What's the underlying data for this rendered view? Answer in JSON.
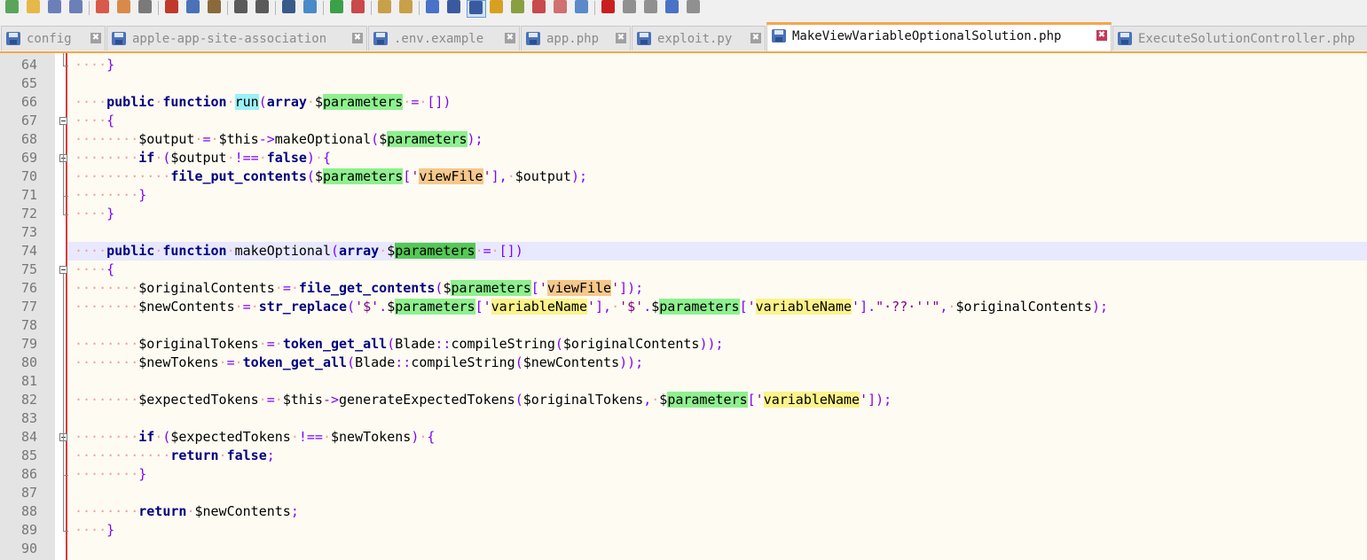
{
  "toolbar": {
    "buttons": [
      "new-file-icon",
      "open-file-icon",
      "save-icon",
      "save-all-icon",
      "close-icon",
      "close-all-icon",
      "print-icon",
      "cut-icon",
      "copy-icon",
      "paste-icon",
      "undo-icon",
      "redo-icon",
      "find-icon",
      "replace-icon",
      "zoom-in-icon",
      "zoom-out-icon",
      "sync-vertical-icon",
      "sync-horizontal-icon",
      "word-wrap-icon",
      "show-all-chars-icon",
      "indent-guide-icon",
      "language-icon",
      "document-map-icon",
      "function-list-icon",
      "folder-workspace-icon",
      "monitoring-icon",
      "record-macro-icon",
      "stop-macro-icon",
      "play-macro-icon",
      "run-macro-multiple-icon",
      "save-macro-icon"
    ]
  },
  "tabs": [
    {
      "label": "config",
      "active": false
    },
    {
      "label": "apple-app-site-association",
      "active": false
    },
    {
      "label": ".env.example",
      "active": false
    },
    {
      "label": "app.php",
      "active": false
    },
    {
      "label": "exploit.py",
      "active": false
    },
    {
      "label": "MakeViewVariableOptionalSolution.php",
      "active": true
    },
    {
      "label": "ExecuteSolutionController.php",
      "active": false
    }
  ],
  "colors": {
    "tab_accent": "#f5a54a",
    "keyword": "#000080",
    "operator": "#8000ff",
    "string": "#800080",
    "whitespace_dots": "#f0a0a0",
    "smart_highlight": "#8ef08e",
    "current_line": "#e8e8ff",
    "change_marker": "#d93b3b"
  },
  "editor": {
    "current_line": 74,
    "lines": [
      {
        "n": "64",
        "fold": "end",
        "tokens": [
          [
            "d",
            "····"
          ],
          [
            "op",
            "}"
          ]
        ]
      },
      {
        "n": "65",
        "fold": "",
        "tokens": []
      },
      {
        "n": "66",
        "fold": "",
        "tokens": [
          [
            "d",
            "····"
          ],
          [
            "kw",
            "public"
          ],
          [
            "d",
            "·"
          ],
          [
            "kw",
            "function"
          ],
          [
            "d",
            "·"
          ],
          [
            "c",
            "run"
          ],
          [
            "op",
            "("
          ],
          [
            "kw",
            "array"
          ],
          [
            "d",
            "·"
          ],
          [
            "pl",
            "$"
          ],
          [
            "g",
            "parameters"
          ],
          [
            "d",
            "·"
          ],
          [
            "op",
            "="
          ],
          [
            "d",
            "·"
          ],
          [
            "op",
            "[])"
          ]
        ]
      },
      {
        "n": "67",
        "fold": "start",
        "tokens": [
          [
            "d",
            "····"
          ],
          [
            "op",
            "{"
          ]
        ]
      },
      {
        "n": "68",
        "fold": "",
        "tokens": [
          [
            "d",
            "········"
          ],
          [
            "pl",
            "$output"
          ],
          [
            "d",
            "·"
          ],
          [
            "op",
            "="
          ],
          [
            "d",
            "·"
          ],
          [
            "pl",
            "$this"
          ],
          [
            "op",
            "->"
          ],
          [
            "pl",
            "makeOptional"
          ],
          [
            "op",
            "("
          ],
          [
            "pl",
            "$"
          ],
          [
            "g",
            "parameters"
          ],
          [
            "op",
            ");"
          ]
        ]
      },
      {
        "n": "69",
        "fold": "start",
        "tokens": [
          [
            "d",
            "········"
          ],
          [
            "kw",
            "if"
          ],
          [
            "d",
            "·"
          ],
          [
            "op",
            "("
          ],
          [
            "pl",
            "$output"
          ],
          [
            "d",
            "·"
          ],
          [
            "op",
            "!=="
          ],
          [
            "d",
            "·"
          ],
          [
            "kw",
            "false"
          ],
          [
            "op",
            ")"
          ],
          [
            "d",
            "·"
          ],
          [
            "op",
            "{"
          ]
        ]
      },
      {
        "n": "70",
        "fold": "",
        "tokens": [
          [
            "d",
            "············"
          ],
          [
            "kw",
            "file_put_contents"
          ],
          [
            "op",
            "("
          ],
          [
            "pl",
            "$"
          ],
          [
            "g",
            "parameters"
          ],
          [
            "op",
            "["
          ],
          [
            "str",
            "'"
          ],
          [
            "o",
            "viewFile"
          ],
          [
            "str",
            "'"
          ],
          [
            "op",
            "],"
          ],
          [
            "d",
            "·"
          ],
          [
            "pl",
            "$output"
          ],
          [
            "op",
            ");"
          ]
        ]
      },
      {
        "n": "71",
        "fold": "end",
        "tokens": [
          [
            "d",
            "········"
          ],
          [
            "op",
            "}"
          ]
        ]
      },
      {
        "n": "72",
        "fold": "end",
        "tokens": [
          [
            "d",
            "····"
          ],
          [
            "op",
            "}"
          ]
        ]
      },
      {
        "n": "73",
        "fold": "",
        "tokens": []
      },
      {
        "n": "74",
        "fold": "",
        "tokens": [
          [
            "d",
            "····"
          ],
          [
            "kw",
            "public"
          ],
          [
            "d",
            "·"
          ],
          [
            "kw",
            "function"
          ],
          [
            "d",
            "·"
          ],
          [
            "pl",
            "makeOptional"
          ],
          [
            "op",
            "("
          ],
          [
            "kw",
            "array"
          ],
          [
            "d",
            "·"
          ],
          [
            "pl",
            "$"
          ],
          [
            "gd",
            "parameters"
          ],
          [
            "d",
            "·"
          ],
          [
            "op",
            "="
          ],
          [
            "d",
            "·"
          ],
          [
            "op",
            "[])"
          ]
        ]
      },
      {
        "n": "75",
        "fold": "start",
        "tokens": [
          [
            "d",
            "····"
          ],
          [
            "op",
            "{"
          ]
        ]
      },
      {
        "n": "76",
        "fold": "",
        "tokens": [
          [
            "d",
            "········"
          ],
          [
            "pl",
            "$originalContents"
          ],
          [
            "d",
            "·"
          ],
          [
            "op",
            "="
          ],
          [
            "d",
            "·"
          ],
          [
            "kw",
            "file_get_contents"
          ],
          [
            "op",
            "("
          ],
          [
            "pl",
            "$"
          ],
          [
            "g",
            "parameters"
          ],
          [
            "op",
            "["
          ],
          [
            "str",
            "'"
          ],
          [
            "o",
            "viewFile"
          ],
          [
            "str",
            "'"
          ],
          [
            "op",
            "]);"
          ]
        ]
      },
      {
        "n": "77",
        "fold": "",
        "tokens": [
          [
            "d",
            "········"
          ],
          [
            "pl",
            "$newContents"
          ],
          [
            "d",
            "·"
          ],
          [
            "op",
            "="
          ],
          [
            "d",
            "·"
          ],
          [
            "kw",
            "str_replace"
          ],
          [
            "op",
            "("
          ],
          [
            "str",
            "'$'"
          ],
          [
            "op",
            "."
          ],
          [
            "pl",
            "$"
          ],
          [
            "g",
            "parameters"
          ],
          [
            "op",
            "["
          ],
          [
            "str",
            "'"
          ],
          [
            "y",
            "variableName"
          ],
          [
            "str",
            "'"
          ],
          [
            "op",
            "],"
          ],
          [
            "d",
            "·"
          ],
          [
            "str",
            "'$'"
          ],
          [
            "op",
            "."
          ],
          [
            "pl",
            "$"
          ],
          [
            "g",
            "parameters"
          ],
          [
            "op",
            "["
          ],
          [
            "str",
            "'"
          ],
          [
            "y",
            "variableName"
          ],
          [
            "str",
            "'"
          ],
          [
            "op",
            "]."
          ],
          [
            "str",
            "\"·??·''\""
          ],
          [
            "op",
            ","
          ],
          [
            "d",
            "·"
          ],
          [
            "pl",
            "$originalContents"
          ],
          [
            "op",
            ");"
          ]
        ]
      },
      {
        "n": "78",
        "fold": "",
        "tokens": []
      },
      {
        "n": "79",
        "fold": "",
        "tokens": [
          [
            "d",
            "········"
          ],
          [
            "pl",
            "$originalTokens"
          ],
          [
            "d",
            "·"
          ],
          [
            "op",
            "="
          ],
          [
            "d",
            "·"
          ],
          [
            "kw",
            "token_get_all"
          ],
          [
            "op",
            "("
          ],
          [
            "pl",
            "Blade"
          ],
          [
            "op",
            "::"
          ],
          [
            "pl",
            "compileString"
          ],
          [
            "op",
            "("
          ],
          [
            "pl",
            "$originalContents"
          ],
          [
            "op",
            "));"
          ]
        ]
      },
      {
        "n": "80",
        "fold": "",
        "tokens": [
          [
            "d",
            "········"
          ],
          [
            "pl",
            "$newTokens"
          ],
          [
            "d",
            "·"
          ],
          [
            "op",
            "="
          ],
          [
            "d",
            "·"
          ],
          [
            "kw",
            "token_get_all"
          ],
          [
            "op",
            "("
          ],
          [
            "pl",
            "Blade"
          ],
          [
            "op",
            "::"
          ],
          [
            "pl",
            "compileString"
          ],
          [
            "op",
            "("
          ],
          [
            "pl",
            "$newContents"
          ],
          [
            "op",
            "));"
          ]
        ]
      },
      {
        "n": "81",
        "fold": "",
        "tokens": []
      },
      {
        "n": "82",
        "fold": "",
        "tokens": [
          [
            "d",
            "········"
          ],
          [
            "pl",
            "$expectedTokens"
          ],
          [
            "d",
            "·"
          ],
          [
            "op",
            "="
          ],
          [
            "d",
            "·"
          ],
          [
            "pl",
            "$this"
          ],
          [
            "op",
            "->"
          ],
          [
            "pl",
            "generateExpectedTokens"
          ],
          [
            "op",
            "("
          ],
          [
            "pl",
            "$originalTokens"
          ],
          [
            "op",
            ","
          ],
          [
            "d",
            "·"
          ],
          [
            "pl",
            "$"
          ],
          [
            "g",
            "parameters"
          ],
          [
            "op",
            "["
          ],
          [
            "str",
            "'"
          ],
          [
            "y",
            "variableName"
          ],
          [
            "str",
            "'"
          ],
          [
            "op",
            "]);"
          ]
        ]
      },
      {
        "n": "83",
        "fold": "",
        "tokens": []
      },
      {
        "n": "84",
        "fold": "start",
        "tokens": [
          [
            "d",
            "········"
          ],
          [
            "kw",
            "if"
          ],
          [
            "d",
            "·"
          ],
          [
            "op",
            "("
          ],
          [
            "pl",
            "$expectedTokens"
          ],
          [
            "d",
            "·"
          ],
          [
            "op",
            "!=="
          ],
          [
            "d",
            "·"
          ],
          [
            "pl",
            "$newTokens"
          ],
          [
            "op",
            ")"
          ],
          [
            "d",
            "·"
          ],
          [
            "op",
            "{"
          ]
        ]
      },
      {
        "n": "85",
        "fold": "",
        "tokens": [
          [
            "d",
            "············"
          ],
          [
            "kw",
            "return"
          ],
          [
            "d",
            "·"
          ],
          [
            "kw",
            "false"
          ],
          [
            "op",
            ";"
          ]
        ]
      },
      {
        "n": "86",
        "fold": "end",
        "tokens": [
          [
            "d",
            "········"
          ],
          [
            "op",
            "}"
          ]
        ]
      },
      {
        "n": "87",
        "fold": "",
        "tokens": []
      },
      {
        "n": "88",
        "fold": "",
        "tokens": [
          [
            "d",
            "········"
          ],
          [
            "kw",
            "return"
          ],
          [
            "d",
            "·"
          ],
          [
            "pl",
            "$newContents"
          ],
          [
            "op",
            ";"
          ]
        ]
      },
      {
        "n": "89",
        "fold": "end",
        "tokens": [
          [
            "d",
            "····"
          ],
          [
            "op",
            "}"
          ]
        ]
      },
      {
        "n": "90",
        "fold": "",
        "tokens": []
      }
    ]
  }
}
